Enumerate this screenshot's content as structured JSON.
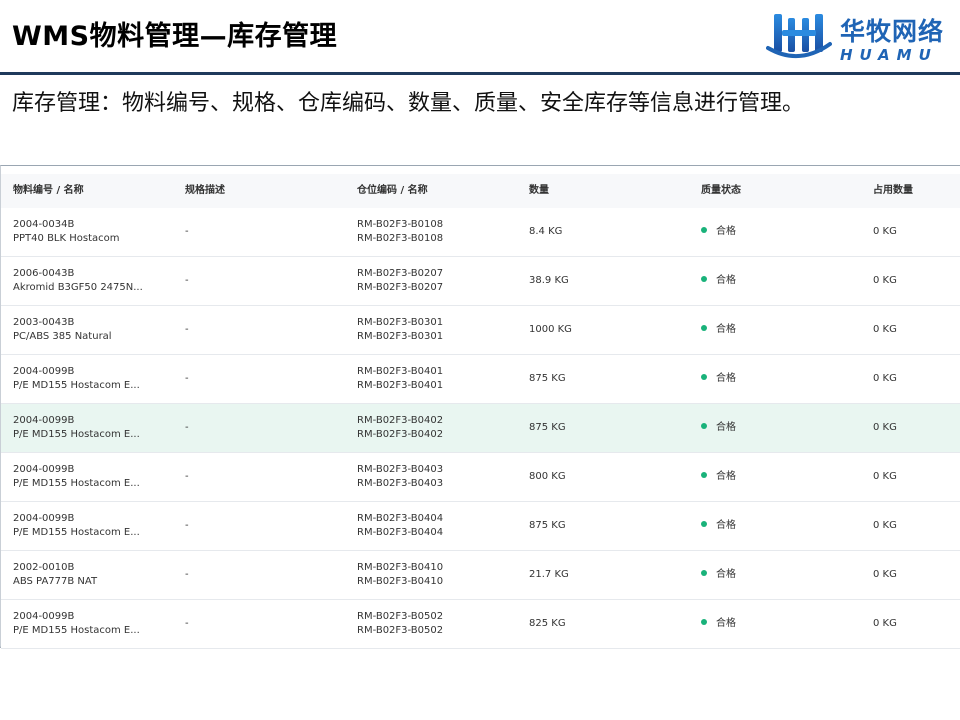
{
  "slide": {
    "title": "WMS物料管理—库存管理",
    "description": "库存管理：物料编号、规格、仓库编码、数量、质量、安全库存等信息进行管理。"
  },
  "logo": {
    "icon": "huamu-logo-icon",
    "cn": "华牧网络",
    "en": "HUAMU",
    "color": "#1f64b5"
  },
  "colors": {
    "header_rule": "#1f3a5c",
    "status_ok": "#19b27a",
    "row_highlight": "#e9f6f1"
  },
  "table": {
    "columns": [
      "物料编号 / 名称",
      "规格描述",
      "仓位编码 / 名称",
      "数量",
      "质量状态",
      "占用数量"
    ],
    "rows": [
      {
        "material_code": "2004-0034B",
        "material_name": "PPT40 BLK Hostacom",
        "spec": "-",
        "location_code": "RM-B02F3-B0108",
        "location_name": "RM-B02F3-B0108",
        "quantity": "8.4 KG",
        "quality": "合格",
        "occupied": "0 KG"
      },
      {
        "material_code": "2006-0043B",
        "material_name": "Akromid B3GF50 2475N...",
        "spec": "-",
        "location_code": "RM-B02F3-B0207",
        "location_name": "RM-B02F3-B0207",
        "quantity": "38.9 KG",
        "quality": "合格",
        "occupied": "0 KG"
      },
      {
        "material_code": "2003-0043B",
        "material_name": "PC/ABS 385 Natural",
        "spec": "-",
        "location_code": "RM-B02F3-B0301",
        "location_name": "RM-B02F3-B0301",
        "quantity": "1000 KG",
        "quality": "合格",
        "occupied": "0 KG"
      },
      {
        "material_code": "2004-0099B",
        "material_name": "P/E MD155 Hostacom E...",
        "spec": "-",
        "location_code": "RM-B02F3-B0401",
        "location_name": "RM-B02F3-B0401",
        "quantity": "875 KG",
        "quality": "合格",
        "occupied": "0 KG"
      },
      {
        "material_code": "2004-0099B",
        "material_name": "P/E MD155 Hostacom E...",
        "spec": "-",
        "location_code": "RM-B02F3-B0402",
        "location_name": "RM-B02F3-B0402",
        "quantity": "875 KG",
        "quality": "合格",
        "occupied": "0 KG"
      },
      {
        "material_code": "2004-0099B",
        "material_name": "P/E MD155 Hostacom E...",
        "spec": "-",
        "location_code": "RM-B02F3-B0403",
        "location_name": "RM-B02F3-B0403",
        "quantity": "800 KG",
        "quality": "合格",
        "occupied": "0 KG"
      },
      {
        "material_code": "2004-0099B",
        "material_name": "P/E MD155 Hostacom E...",
        "spec": "-",
        "location_code": "RM-B02F3-B0404",
        "location_name": "RM-B02F3-B0404",
        "quantity": "875 KG",
        "quality": "合格",
        "occupied": "0 KG"
      },
      {
        "material_code": "2002-0010B",
        "material_name": "ABS PA777B NAT",
        "spec": "-",
        "location_code": "RM-B02F3-B0410",
        "location_name": "RM-B02F3-B0410",
        "quantity": "21.7 KG",
        "quality": "合格",
        "occupied": "0 KG"
      },
      {
        "material_code": "2004-0099B",
        "material_name": "P/E MD155 Hostacom E...",
        "spec": "-",
        "location_code": "RM-B02F3-B0502",
        "location_name": "RM-B02F3-B0502",
        "quantity": "825 KG",
        "quality": "合格",
        "occupied": "0 KG"
      }
    ],
    "highlighted_row": 4
  }
}
